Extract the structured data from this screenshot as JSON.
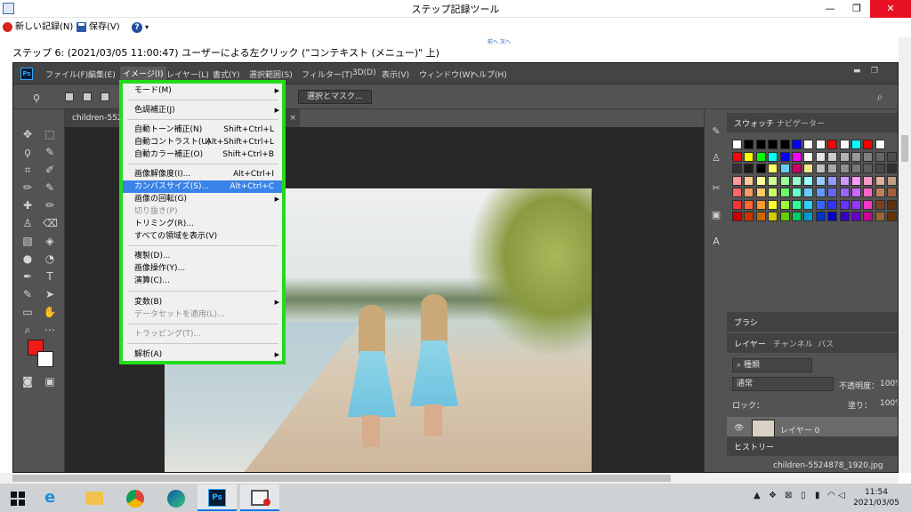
{
  "window": {
    "title": "ステップ記録ツール",
    "controls": {
      "minimize": "—",
      "maximize": "❐",
      "close": "✕"
    }
  },
  "toolbar": {
    "new_record": "新しい記録(N)",
    "save": "保存(V)",
    "help": "?",
    "help_caret": "▾"
  },
  "nav_links": "前へ 次へ",
  "step": {
    "header": "ステップ 6: (2021/03/05 11:00:47) ユーザーによる左クリック (\"コンテキスト (メニュー)\" 上)"
  },
  "photoshop": {
    "logo": "Ps",
    "menus": [
      "ファイル(F)",
      "編集(E)",
      "イメージ(I)",
      "レイヤー(L)",
      "書式(Y)",
      "選択範囲(S)",
      "フィルター(T)",
      "3D(D)",
      "表示(V)",
      "ウィンドウ(W)",
      "ヘルプ(H)"
    ],
    "active_menu": "イメージ(I)",
    "select_and_mask": "選択とマスク...",
    "doc_tab": "children-5524",
    "doc_tab_close": "×",
    "image_menu": [
      {
        "label": "モード(M)",
        "shortcut": "",
        "submenu": true,
        "disabled": false
      },
      {
        "label": "色調補正(J)",
        "shortcut": "",
        "submenu": true,
        "disabled": false
      },
      {
        "label": "自動トーン補正(N)",
        "shortcut": "Shift+Ctrl+L",
        "submenu": false,
        "disabled": false
      },
      {
        "label": "自動コントラスト(U)",
        "shortcut": "Alt+Shift+Ctrl+L",
        "submenu": false,
        "disabled": false
      },
      {
        "label": "自動カラー補正(O)",
        "shortcut": "Shift+Ctrl+B",
        "submenu": false,
        "disabled": false
      },
      {
        "label": "画像解像度(I)...",
        "shortcut": "Alt+Ctrl+I",
        "submenu": false,
        "disabled": false
      },
      {
        "label": "カンバスサイズ(S)...",
        "shortcut": "Alt+Ctrl+C",
        "submenu": false,
        "disabled": false,
        "highlighted": true
      },
      {
        "label": "画像の回転(G)",
        "shortcut": "",
        "submenu": true,
        "disabled": false
      },
      {
        "label": "切り抜き(P)",
        "shortcut": "",
        "submenu": false,
        "disabled": true
      },
      {
        "label": "トリミング(R)...",
        "shortcut": "",
        "submenu": false,
        "disabled": false
      },
      {
        "label": "すべての領域を表示(V)",
        "shortcut": "",
        "submenu": false,
        "disabled": false
      },
      {
        "label": "複製(D)...",
        "shortcut": "",
        "submenu": false,
        "disabled": false
      },
      {
        "label": "画像操作(Y)...",
        "shortcut": "",
        "submenu": false,
        "disabled": false
      },
      {
        "label": "演算(C)...",
        "shortcut": "",
        "submenu": false,
        "disabled": false
      },
      {
        "label": "変数(B)",
        "shortcut": "",
        "submenu": true,
        "disabled": false
      },
      {
        "label": "データセットを適用(L)...",
        "shortcut": "",
        "submenu": false,
        "disabled": true
      },
      {
        "label": "トラッピング(T)...",
        "shortcut": "",
        "submenu": false,
        "disabled": true
      },
      {
        "label": "解析(A)",
        "shortcut": "",
        "submenu": true,
        "disabled": false
      }
    ],
    "panels": {
      "swatch_tabs": [
        "スウォッチ",
        "ナビゲーター"
      ],
      "brush_tab": "ブラシ",
      "layer_tabs": [
        "レイヤー",
        "チャンネル",
        "パス"
      ],
      "filter_kind": "種類",
      "blend_mode": "通常",
      "opacity_label": "不透明度：",
      "opacity_value": "100%",
      "lock_label": "ロック：",
      "fill_label": "塗り：",
      "fill_value": "100%",
      "layer_name": "レイヤー 0",
      "history_tab": "ヒストリー",
      "history_item": "children-5524878_1920.jpg"
    },
    "fg_color": "#ee1b1b",
    "bg_color": "#ffffff"
  },
  "taskbar": {
    "time": "11:54",
    "date": "2021/03/05"
  }
}
